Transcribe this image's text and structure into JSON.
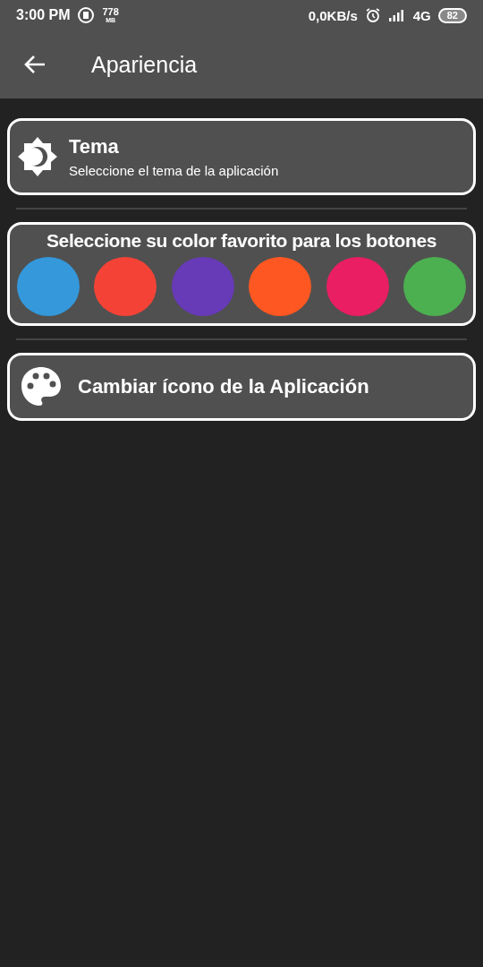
{
  "status_bar": {
    "time": "3:00 PM",
    "memory": "778",
    "memory_unit": "MB",
    "speed": "0,0KB/s",
    "network": "4G",
    "battery": "82"
  },
  "app_bar": {
    "title": "Apariencia"
  },
  "theme": {
    "title": "Tema",
    "subtitle": "Seleccione el tema de la aplicación"
  },
  "colors": {
    "title": "Seleccione su color favorito para los botones",
    "swatches": [
      {
        "color": "#3498db"
      },
      {
        "color": "#f44336"
      },
      {
        "color": "#673ab7"
      },
      {
        "color": "#ff5722"
      },
      {
        "color": "#e91e63"
      },
      {
        "color": "#4caf50"
      }
    ]
  },
  "icon_setting": {
    "title": "Cambiar ícono de la Aplicación"
  }
}
